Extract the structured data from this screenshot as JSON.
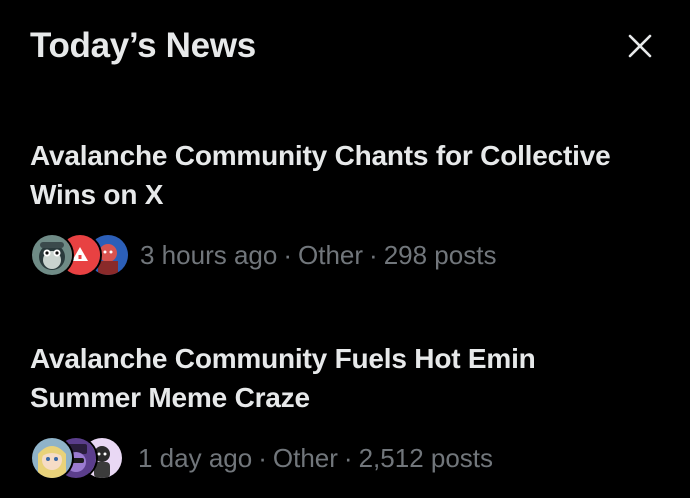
{
  "header": {
    "title": "Today’s News",
    "close_icon": "close-icon"
  },
  "colors": {
    "background": "#000000",
    "primary_text": "#e7e9ea",
    "secondary_text": "#71767b"
  },
  "news": [
    {
      "headline": "Avalanche Community Chants for Collective Wins on X",
      "time": "3 hours ago",
      "category": "Other",
      "posts": "298 posts",
      "avatars": [
        "avatar-penguin-icon",
        "avatar-avalanche-logo-icon",
        "avatar-character-icon"
      ]
    },
    {
      "headline": "Avalanche Community Fuels Hot Emin Summer Meme Craze",
      "time": "1 day ago",
      "category": "Other",
      "posts": "2,512 posts",
      "avatars": [
        "avatar-anime-girl-icon",
        "avatar-purple-character-icon",
        "avatar-cartoon-figure-icon"
      ]
    }
  ]
}
